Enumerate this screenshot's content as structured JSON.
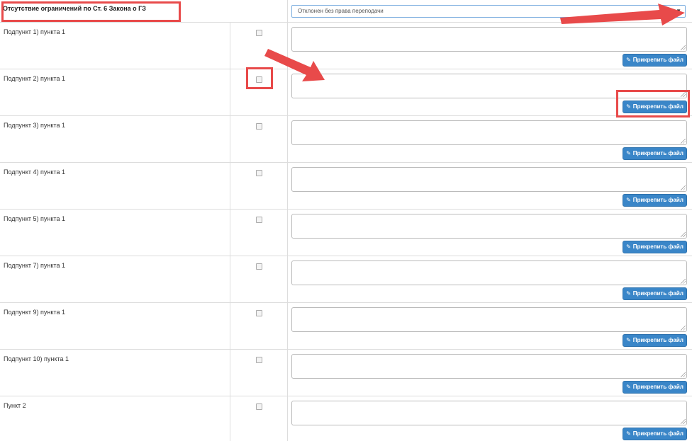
{
  "header": {
    "title": "Отсутствие ограничений по Ст. 6 Закона о ГЗ",
    "select_value": "Отклонен без права переподачи",
    "select_arrow": "▼"
  },
  "attach_label": "Прикрепить файл",
  "attach_icon": "paperclip-icon",
  "rows": [
    {
      "label": "Подпункт 1) пункта 1"
    },
    {
      "label": "Подпункт 2) пункта 1"
    },
    {
      "label": "Подпункт 3) пункта 1"
    },
    {
      "label": "Подпункт 4) пункта 1"
    },
    {
      "label": "Подпункт 5) пункта 1"
    },
    {
      "label": "Подпункт 7) пункта 1"
    },
    {
      "label": "Подпункт 9) пункта 1"
    },
    {
      "label": "Подпункт 10) пункта 1"
    },
    {
      "label": "Пункт 2"
    }
  ],
  "annotation_color": "#e84a4a"
}
